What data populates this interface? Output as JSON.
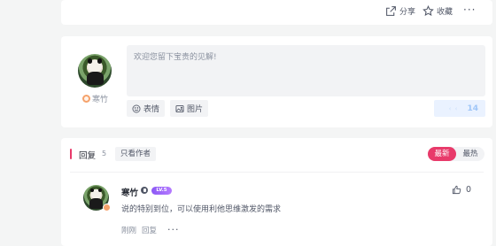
{
  "top_actions": {
    "share_label": "分享",
    "favorite_label": "收藏",
    "more_label": "···"
  },
  "editor": {
    "username": "寒竹",
    "placeholder": "欢迎您留下宝贵的见解!",
    "emoji_label": "表情",
    "image_label": "图片",
    "send_arrow": "‹ ‹",
    "send_count": "14"
  },
  "replies": {
    "title": "回复",
    "count": "5",
    "author_only_label": "只看作者",
    "sort_options": [
      "最新",
      "最热"
    ],
    "active_sort": "最新",
    "items": [
      {
        "username": "寒竹",
        "level": "LV.5",
        "text": "说的特别到位，可以使用利他思维激发的需求",
        "time": "刚刚",
        "reply_label": "回复",
        "more_label": "···",
        "likes": "0"
      }
    ]
  },
  "colors": {
    "accent": "#e83a6a",
    "level_badge": "#8c59f5",
    "page_bg": "#f4f5f5"
  }
}
